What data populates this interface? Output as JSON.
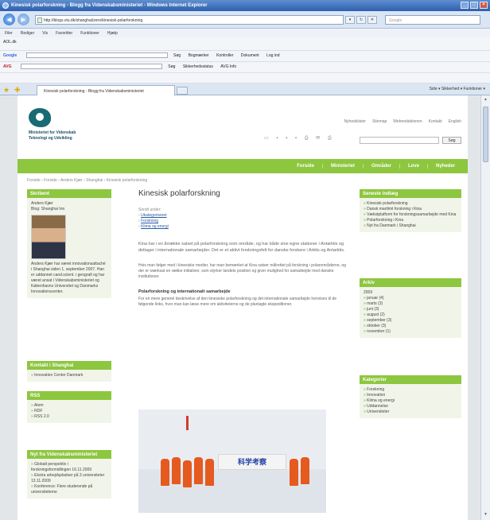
{
  "window": {
    "title": "Kinesisk polarforskning - Blogg fra Videnskabsministeriet - Windows Internet Explorer"
  },
  "address": {
    "url": "http://blogs.vtu.dk/shanghai/zero/kinesisk-polarforskning",
    "search_placeholder": "Google"
  },
  "menu": [
    "Filer",
    "Rediger",
    "Vis",
    "Favoritter",
    "Funktioner",
    "Hjælp"
  ],
  "toolbar_google": {
    "brand": "Google",
    "items": [
      "Søg",
      "Bogmærker",
      "Kontroller",
      "Dokument",
      "Log ind"
    ]
  },
  "toolbar_avg": {
    "brand": "AVG",
    "items": [
      "Søg",
      "Sikkerhedsstatus",
      "AVG Info"
    ]
  },
  "toolbar_aol": {
    "brand": "AOL.dk"
  },
  "tab": {
    "label": "Kinesisk polarforskning - Blogg fra Videnskabsministeriet"
  },
  "right_tools": "Side ▾   Sikkerhed ▾   Funktioner ▾",
  "site": {
    "ministry_lines": [
      "Ministeriet for Videnskab",
      "Teknologi og Udvikling"
    ],
    "toplinks": [
      "Nyhedslister",
      "Sitemap",
      "Webredaktionen",
      "Kontakt",
      "English"
    ],
    "search_button": "Søg",
    "nav": [
      "Forside",
      "Ministeriet",
      "Områder",
      "Love",
      "Nyheder"
    ],
    "breadcrumb": "Forside › Forside › Anders Kjær › Shanghai › Kinesisk polarforskning"
  },
  "left": {
    "author_head": "Skribent",
    "author_name": "Anders Kjær",
    "author_role": "Blog: Shanghai Inn",
    "author_bio": "Anders Kjær har været innovationsattaché i Shanghai siden 1. september 2007. Han er uddannet cand.scient. i geografi og har været ansat i Videnskabsministeriet og Københavns Universitet og Danmarks Innovationscenter.",
    "contact_head": "Kontakt i Shanghai",
    "contact_items": [
      "Innovation Center Danmark"
    ],
    "rss_head": "RSS",
    "rss_items": [
      "Atom",
      "RDF",
      "RSS 2.0"
    ],
    "news_head": "Nyt fra Videnskabsministeriet",
    "news_items": [
      "Globalt perspektiv i forskningsformidlingen 16.11.2009",
      "Ekstra arbejdspladser på 3 universiteter 13.11.2009",
      "Konference: Flere studerende på universiteterne"
    ]
  },
  "main": {
    "title": "Kinesisk polarforskning",
    "posted_label": "Sendt under:",
    "posted_links": [
      "Ukategoriseret"
    ],
    "extra_links": [
      "Forskning",
      "Klima og energi"
    ],
    "lead": "Kina har i en årrække satset på polarforskning som område, og har både sine egne stationer i Antarktis og deltager i internationale samarbejder. Det er et aktivt forskningsfelt for danske forskere i Arktis og Antarktis.",
    "para1": "Hvis man følger med i kinesiske medier, har man bemærket at Kina satser målrettet på forskning i polarområderne, og der er iværksat en række initiativer, som styrker landets position og giver mulighed for samarbejde med danske institutioner.",
    "subhead": "Polarforskning og internationalt samarbejde",
    "para2": "For en mere generel beskrivelse af den kinesiske polarforskning og det internationale samarbejde henvises til de følgende links, hvor man kan læse mere om aktiviteterne og de planlagte ekspeditioner.",
    "banner_text": "科学考察"
  },
  "right": {
    "recent_head": "Seneste indlæg",
    "recent_items": [
      "Kinesisk polarforskning",
      "Dansk maritimt forskning i Kina",
      "Vækstplatform for forskningssamarbejde med Kina",
      "Polarforskning i Kina",
      "Nyt fra Danmark i Shanghai"
    ],
    "archive_head": "Arkiv",
    "archive_year": "2009",
    "archive_items": [
      "januar (4)",
      "marts (3)",
      "juni (3)",
      "august (2)",
      "september (3)",
      "oktober (3)",
      "november (1)"
    ],
    "cat_head": "Kategorier",
    "cat_items": [
      "Forskning",
      "Innovation",
      "Klima og energi",
      "Uddannelse",
      "Universiteter"
    ]
  }
}
